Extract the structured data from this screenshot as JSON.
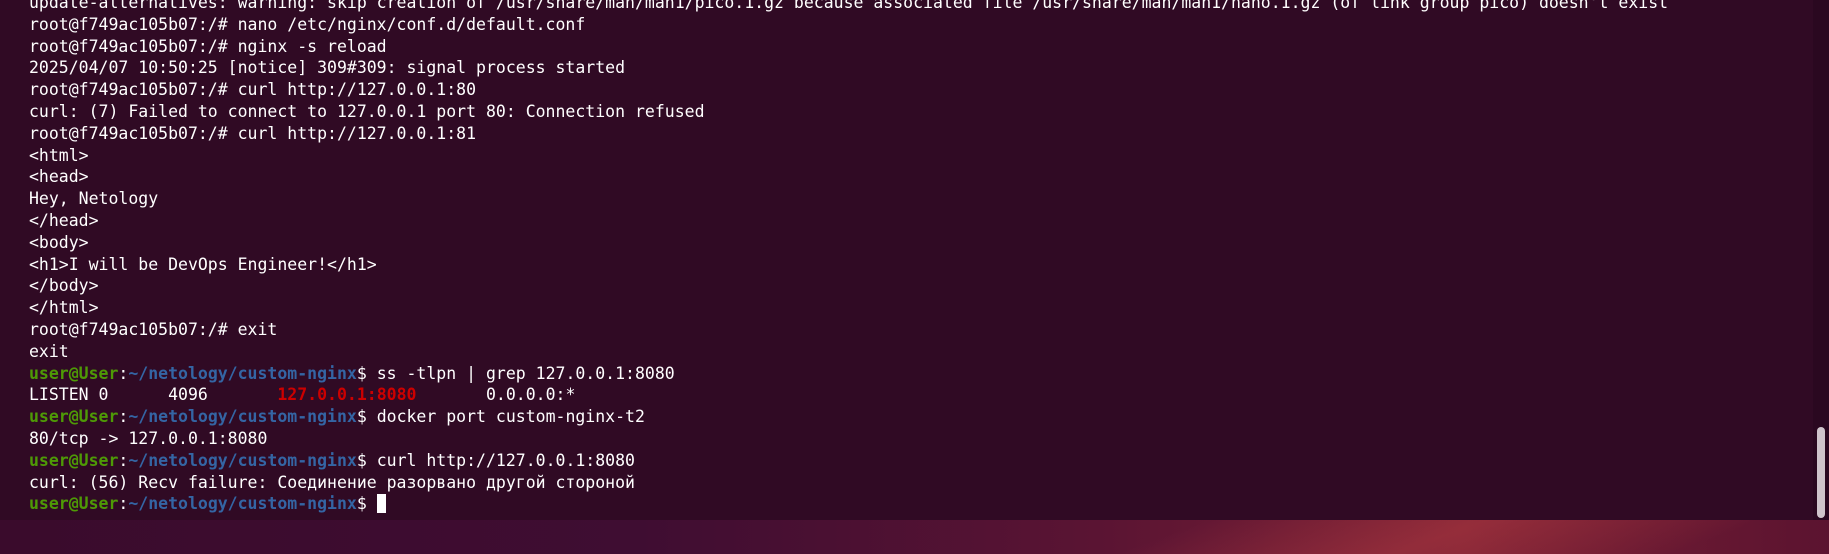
{
  "terminal": {
    "lines": [
      {
        "segments": [
          {
            "text": "update-alternatives: warning: skip creation of /usr/share/man/man1/pico.1.gz because associated file /usr/share/man/man1/nano.1.gz (of link group pico) doesn't exist",
            "style": "plain"
          }
        ]
      },
      {
        "segments": [
          {
            "text": "root@f749ac105b07:/# nano /etc/nginx/conf.d/default.conf",
            "style": "plain"
          }
        ]
      },
      {
        "segments": [
          {
            "text": "root@f749ac105b07:/# nginx -s reload",
            "style": "plain"
          }
        ]
      },
      {
        "segments": [
          {
            "text": "2025/04/07 10:50:25 [notice] 309#309: signal process started",
            "style": "plain"
          }
        ]
      },
      {
        "segments": [
          {
            "text": "root@f749ac105b07:/# curl http://127.0.0.1:80",
            "style": "plain"
          }
        ]
      },
      {
        "segments": [
          {
            "text": "curl: (7) Failed to connect to 127.0.0.1 port 80: Connection refused",
            "style": "plain"
          }
        ]
      },
      {
        "segments": [
          {
            "text": "root@f749ac105b07:/# curl http://127.0.0.1:81",
            "style": "plain"
          }
        ]
      },
      {
        "segments": [
          {
            "text": "<html>",
            "style": "plain"
          }
        ]
      },
      {
        "segments": [
          {
            "text": "<head>",
            "style": "plain"
          }
        ]
      },
      {
        "segments": [
          {
            "text": "Hey, Netology",
            "style": "plain"
          }
        ]
      },
      {
        "segments": [
          {
            "text": "</head>",
            "style": "plain"
          }
        ]
      },
      {
        "segments": [
          {
            "text": "<body>",
            "style": "plain"
          }
        ]
      },
      {
        "segments": [
          {
            "text": "<h1>I will be DevOps Engineer!</h1>",
            "style": "plain"
          }
        ]
      },
      {
        "segments": [
          {
            "text": "</body>",
            "style": "plain"
          }
        ]
      },
      {
        "segments": [
          {
            "text": "</html>",
            "style": "plain"
          }
        ]
      },
      {
        "segments": [
          {
            "text": "root@f749ac105b07:/# exit",
            "style": "plain"
          }
        ]
      },
      {
        "segments": [
          {
            "text": "exit",
            "style": "plain"
          }
        ]
      },
      {
        "segments": [
          {
            "text": "user@User",
            "style": "user"
          },
          {
            "text": ":",
            "style": "plain"
          },
          {
            "text": "~/netology/custom-nginx",
            "style": "path"
          },
          {
            "text": "$ ss -tlpn | grep 127.0.0.1:8080",
            "style": "plain"
          }
        ]
      },
      {
        "segments": [
          {
            "text": "LISTEN 0      4096       ",
            "style": "plain"
          },
          {
            "text": "127.0.0.1:8080",
            "style": "red"
          },
          {
            "text": "       0.0.0.0:*",
            "style": "plain"
          }
        ]
      },
      {
        "segments": [
          {
            "text": "user@User",
            "style": "user"
          },
          {
            "text": ":",
            "style": "plain"
          },
          {
            "text": "~/netology/custom-nginx",
            "style": "path"
          },
          {
            "text": "$ docker port custom-nginx-t2",
            "style": "plain"
          }
        ]
      },
      {
        "segments": [
          {
            "text": "80/tcp -> 127.0.0.1:8080",
            "style": "plain"
          }
        ]
      },
      {
        "segments": [
          {
            "text": "user@User",
            "style": "user"
          },
          {
            "text": ":",
            "style": "plain"
          },
          {
            "text": "~/netology/custom-nginx",
            "style": "path"
          },
          {
            "text": "$ curl http://127.0.0.1:8080",
            "style": "plain"
          }
        ]
      },
      {
        "segments": [
          {
            "text": "curl: (56) Recv failure: Соединение разорвано другой стороной",
            "style": "plain"
          }
        ]
      },
      {
        "segments": [
          {
            "text": "user@User",
            "style": "user"
          },
          {
            "text": ":",
            "style": "plain"
          },
          {
            "text": "~/netology/custom-nginx",
            "style": "path"
          },
          {
            "text": "$ ",
            "style": "plain"
          }
        ],
        "cursor": true
      }
    ]
  },
  "colors": {
    "background": "#300a24",
    "foreground": "#ffffff",
    "prompt_user": "#4e9a06",
    "prompt_path": "#3465a4",
    "highlight_match": "#cc0000"
  }
}
